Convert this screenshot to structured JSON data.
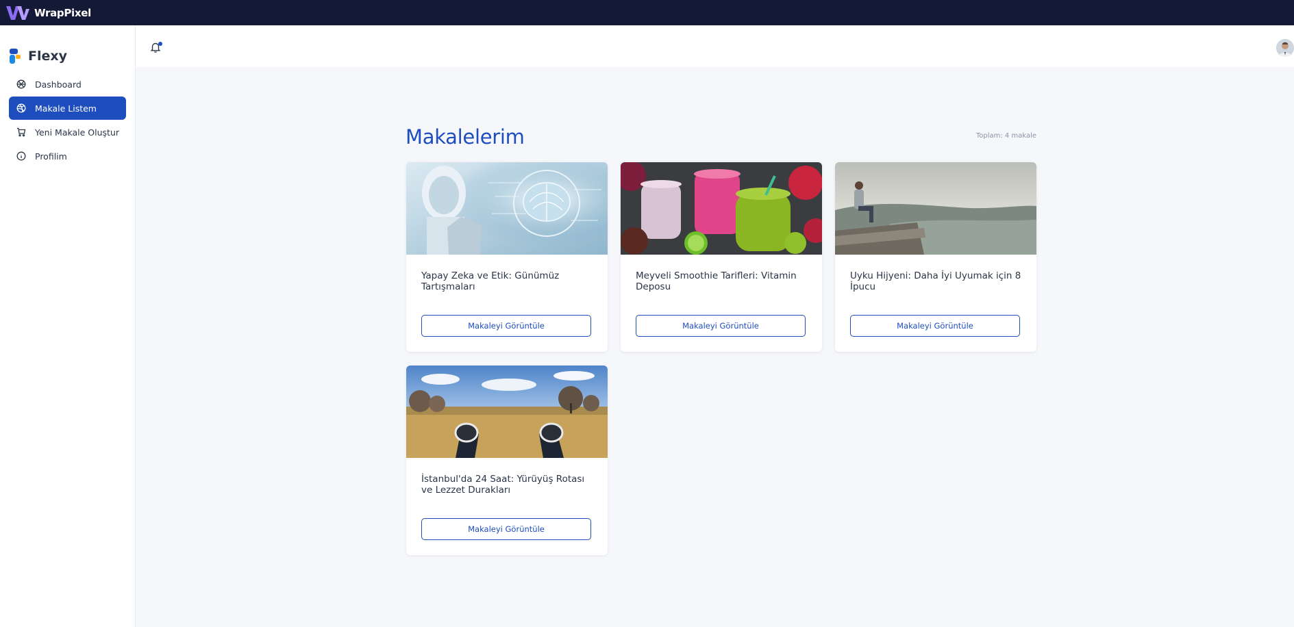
{
  "topbar": {
    "brand": "WrapPixel"
  },
  "sidebar": {
    "brand": "Flexy",
    "items": [
      {
        "label": "Dashboard",
        "icon": "aperture-icon",
        "active": false
      },
      {
        "label": "Makale Listem",
        "icon": "dribbble-icon",
        "active": true
      },
      {
        "label": "Yeni Makale Oluştur",
        "icon": "cart-icon",
        "active": false
      },
      {
        "label": "Profilim",
        "icon": "info-icon",
        "active": false
      }
    ]
  },
  "header": {
    "notification_icon": "bell-icon",
    "avatar": "user-avatar"
  },
  "main": {
    "title": "Makalelerim",
    "total": "Toplam: 4 makale",
    "cards": [
      {
        "title": "Yapay Zeka ve Etik: Günümüz Tartışmaları",
        "button": "Makaleyi Görüntüle",
        "image": "ai-robot-brain"
      },
      {
        "title": "Meyveli Smoothie Tarifleri: Vitamin Deposu",
        "button": "Makaleyi Görüntüle",
        "image": "fruit-smoothies"
      },
      {
        "title": "Uyku Hijyeni: Daha İyi Uyumak için 8 İpucu",
        "button": "Makaleyi Görüntüle",
        "image": "man-on-cliff"
      },
      {
        "title": "İstanbul'da 24 Saat: Yürüyüş Rotası ve Lezzet Durakları",
        "button": "Makaleyi Görüntüle",
        "image": "sneakers-on-field"
      }
    ]
  },
  "colors": {
    "primary": "#1e4dbd",
    "topbar": "#141a36",
    "background": "#f5f7fa"
  }
}
